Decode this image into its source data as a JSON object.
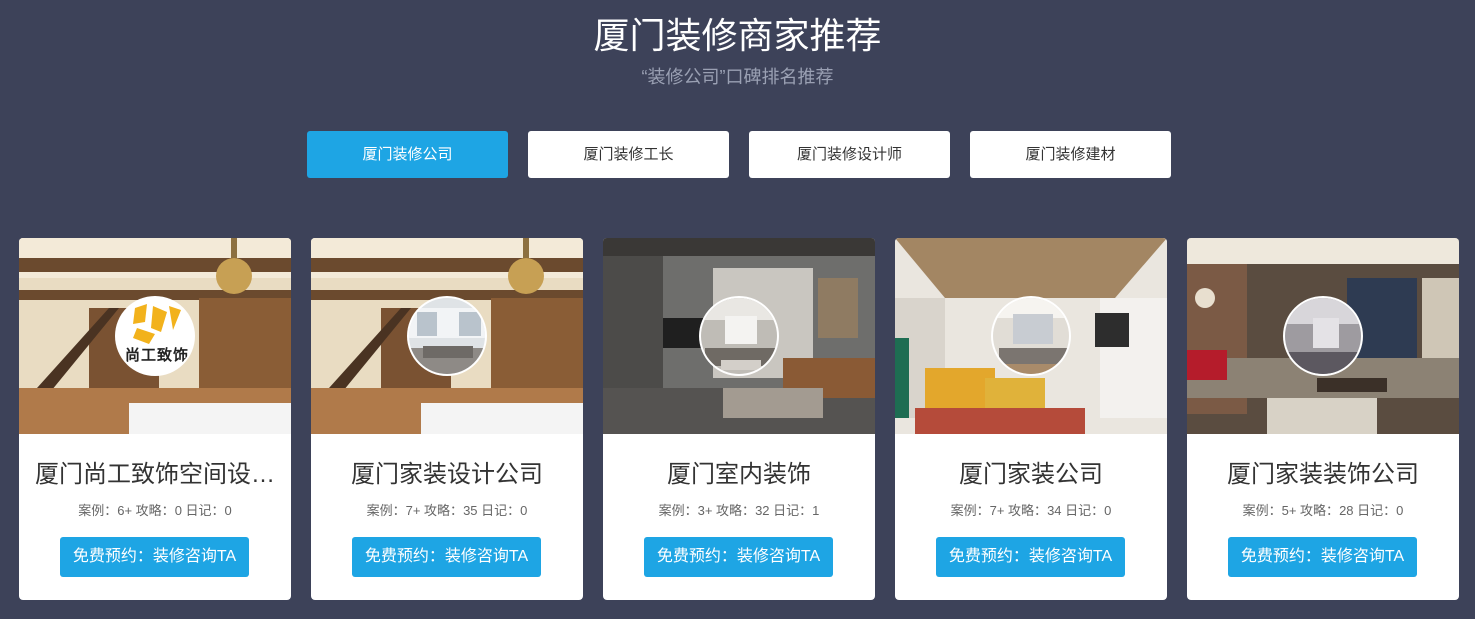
{
  "header": {
    "title": "厦门装修商家推荐",
    "subtitle": "“装修公司”口碑排名推荐"
  },
  "tabs": [
    {
      "label": "厦门装修公司",
      "active": true
    },
    {
      "label": "厦门装修工长",
      "active": false
    },
    {
      "label": "厦门装修设计师",
      "active": false
    },
    {
      "label": "厦门装修建材",
      "active": false
    }
  ],
  "colors": {
    "background": "#3d4259",
    "accent": "#1ea5e4",
    "card": "#ffffff"
  },
  "cards": [
    {
      "name": "厦门尚工致饰空间设…",
      "stats_prefix": "案例：",
      "cases": "6+",
      "guides_label": " 攻略：",
      "guides": "0",
      "diary_label": " 日记：",
      "diary": "0",
      "cta": "免费预约：装修咨询TA",
      "avatar_logo_text": "尚工致饰"
    },
    {
      "name": "厦门家装设计公司",
      "stats_prefix": "案例：",
      "cases": "7+",
      "guides_label": " 攻略：",
      "guides": "35",
      "diary_label": " 日记：",
      "diary": "0",
      "cta": "免费预约：装修咨询TA"
    },
    {
      "name": "厦门室内装饰",
      "stats_prefix": "案例：",
      "cases": "3+",
      "guides_label": " 攻略：",
      "guides": "32",
      "diary_label": " 日记：",
      "diary": "1",
      "cta": "免费预约：装修咨询TA"
    },
    {
      "name": "厦门家装公司",
      "stats_prefix": "案例：",
      "cases": "7+",
      "guides_label": " 攻略：",
      "guides": "34",
      "diary_label": " 日记：",
      "diary": "0",
      "cta": "免费预约：装修咨询TA"
    },
    {
      "name": "厦门家装装饰公司",
      "stats_prefix": "案例：",
      "cases": "5+",
      "guides_label": " 攻略：",
      "guides": "28",
      "diary_label": " 日记：",
      "diary": "0",
      "cta": "免费预约：装修咨询TA"
    }
  ]
}
